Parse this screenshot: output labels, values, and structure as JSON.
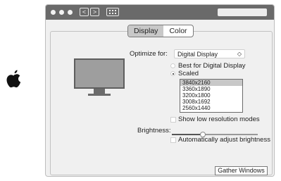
{
  "apple_logo": {
    "icon": "apple-icon",
    "color": "#111111"
  },
  "titlebar": {
    "back_glyph": "<",
    "forward_glyph": ">",
    "grid_icon": "grid-icon"
  },
  "tabs": [
    {
      "label": "Display",
      "active": true
    },
    {
      "label": "Color",
      "active": false
    }
  ],
  "optimize": {
    "label": "Optimize for:",
    "value": "Digital Display",
    "arrow": "◇"
  },
  "resolution": {
    "options": [
      {
        "label": "Best for Digital Display",
        "selected": false
      },
      {
        "label": "Scaled",
        "selected": true
      }
    ],
    "scaled_list": [
      {
        "label": "3840x2160",
        "selected": true
      },
      {
        "label": "3360x1890",
        "selected": false
      },
      {
        "label": "3200x1800",
        "selected": false
      },
      {
        "label": "3008x1692",
        "selected": false
      },
      {
        "label": "2560x1440",
        "selected": false
      }
    ],
    "show_low_res_label": "Show low resolution modes"
  },
  "brightness": {
    "label": "Brightness:",
    "level": 0.36,
    "auto_label": "Automatically adjust brightness"
  },
  "gather_button": "Gather Windows"
}
